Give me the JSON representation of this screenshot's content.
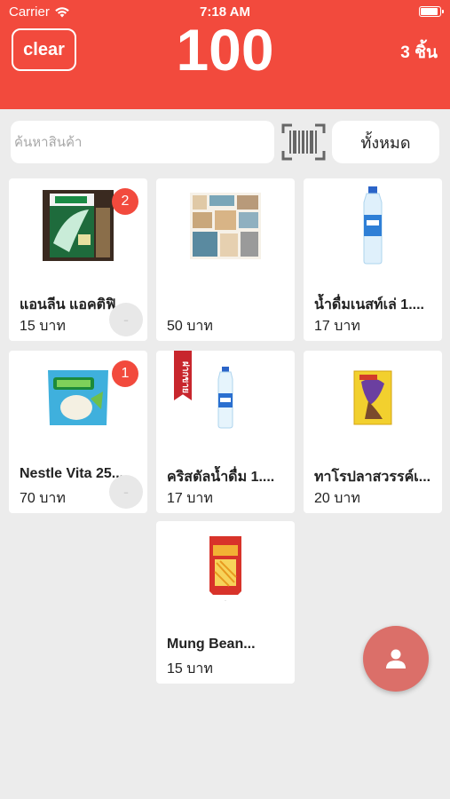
{
  "status_bar": {
    "carrier": "Carrier",
    "time": "7:18 AM"
  },
  "header": {
    "clear_label": "clear",
    "total": "100",
    "count_label": "3 ชิ้น"
  },
  "search": {
    "placeholder": "ค้นหาสินค้า",
    "value": ""
  },
  "filter": {
    "label": "ทั้งหมด"
  },
  "colors": {
    "header_bg": "#f24a3d",
    "badge": "#f24a3d",
    "fab": "#db6f69",
    "background": "#ececec"
  },
  "products": [
    {
      "name": "แอนลีน แอคติฟิ...",
      "price": "15 บาท",
      "badge": "2",
      "has_minus": true
    },
    {
      "name": "",
      "price": "50 บาท"
    },
    {
      "name": "น้ำดื่มเนสท์เล่ 1....",
      "price": "17 บาท"
    },
    {
      "name": "Nestle Vita 25...",
      "price": "70 บาท",
      "badge": "1",
      "has_minus": true
    },
    {
      "name": "คริสตัลน้ำดื่ม 1....",
      "price": "17 บาท",
      "ribbon": "ฝากขาย"
    },
    {
      "name": "ทาโรปลาสวรรค์เ...",
      "price": "20 บาท"
    },
    {
      "name": "Mung Bean...",
      "price": "15 บาท"
    }
  ],
  "icons": {
    "wifi": "wifi-icon",
    "battery": "battery-icon",
    "barcode": "barcode-icon",
    "person": "person-icon",
    "minus": "minus-icon"
  },
  "minus_symbol": "-"
}
